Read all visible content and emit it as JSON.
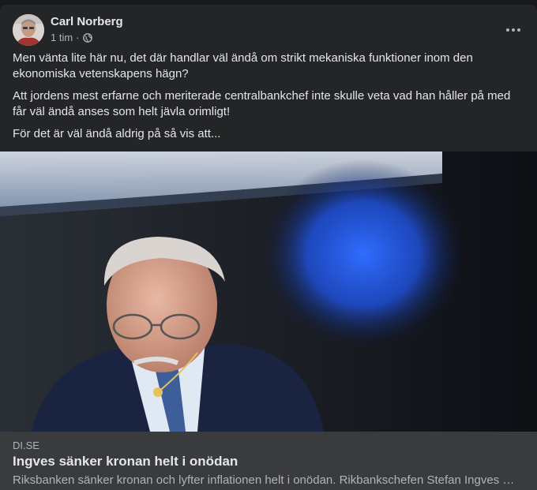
{
  "post": {
    "author": "Carl Norberg",
    "time": "1 tim",
    "separator": "·",
    "privacy_icon": "globe-icon",
    "menu_icon": "more-options-icon",
    "paragraphs": [
      "Men vänta lite här nu, det där handlar väl  ändå om strikt mekaniska funktioner inom den ekonomiska vetenskapens hägn?",
      "Att jordens mest erfarne och  meriterade centralbankchef inte skulle veta vad han håller på med får väl ändå anses som helt jävla orimligt!",
      "För det är väl ändå aldrig på så vis att..."
    ]
  },
  "link": {
    "domain": "DI.SE",
    "title": "Ingves sänker kronan helt i onödan",
    "description": "Riksbanken sänker kronan och lyfter inflationen helt i onödan. Rikbankschefen Stefan Ingves …"
  },
  "colors": {
    "card_bg": "#242526",
    "link_bg": "#3a3b3c",
    "text_primary": "#e4e6eb",
    "text_secondary": "#b0b3b8"
  }
}
